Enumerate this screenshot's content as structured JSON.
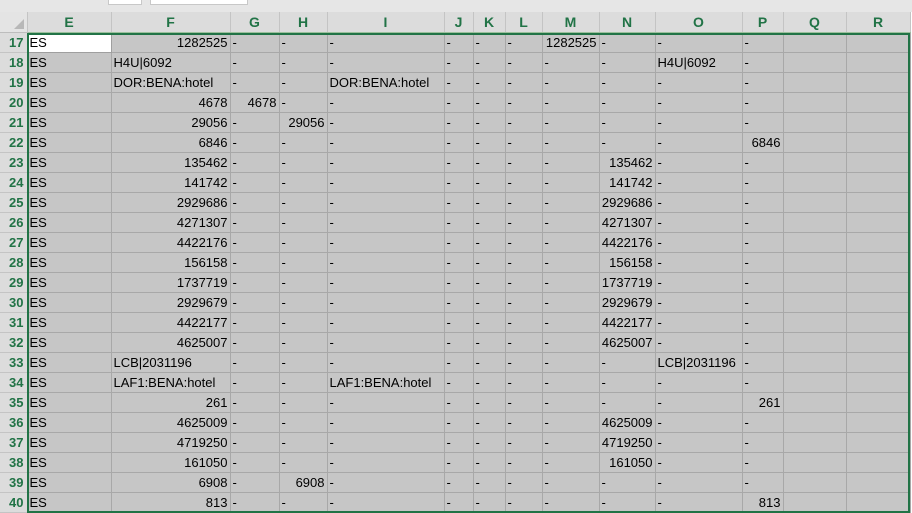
{
  "columns": [
    "E",
    "F",
    "G",
    "H",
    "I",
    "J",
    "K",
    "L",
    "M",
    "N",
    "O",
    "P",
    "Q",
    "R"
  ],
  "rows": [
    {
      "n": "17",
      "c": [
        "ES",
        "1282525",
        "-",
        "-",
        "-",
        "-",
        "-",
        "-",
        "1282525",
        "-",
        "-",
        "-",
        "",
        ""
      ]
    },
    {
      "n": "18",
      "c": [
        "ES",
        "H4U|6092",
        "-",
        "-",
        "-",
        "-",
        "-",
        "-",
        "-",
        "-",
        "H4U|6092",
        "-",
        "",
        ""
      ]
    },
    {
      "n": "19",
      "c": [
        "ES",
        "DOR:BENA:hotel",
        "-",
        "-",
        "DOR:BENA:hotel",
        "-",
        "-",
        "-",
        "-",
        "-",
        "-",
        "-",
        "",
        ""
      ]
    },
    {
      "n": "20",
      "c": [
        "ES",
        "4678",
        "4678",
        "-",
        "-",
        "-",
        "-",
        "-",
        "-",
        "-",
        "-",
        "-",
        "",
        ""
      ]
    },
    {
      "n": "21",
      "c": [
        "ES",
        "29056",
        "-",
        "29056",
        "-",
        "-",
        "-",
        "-",
        "-",
        "-",
        "-",
        "-",
        "",
        ""
      ]
    },
    {
      "n": "22",
      "c": [
        "ES",
        "6846",
        "-",
        "-",
        "-",
        "-",
        "-",
        "-",
        "-",
        "-",
        "-",
        "6846",
        "",
        ""
      ]
    },
    {
      "n": "23",
      "c": [
        "ES",
        "135462",
        "-",
        "-",
        "-",
        "-",
        "-",
        "-",
        "-",
        "135462",
        "-",
        "-",
        "",
        ""
      ]
    },
    {
      "n": "24",
      "c": [
        "ES",
        "141742",
        "-",
        "-",
        "-",
        "-",
        "-",
        "-",
        "-",
        "141742",
        "-",
        "-",
        "",
        ""
      ]
    },
    {
      "n": "25",
      "c": [
        "ES",
        "2929686",
        "-",
        "-",
        "-",
        "-",
        "-",
        "-",
        "-",
        "2929686",
        "-",
        "-",
        "",
        ""
      ]
    },
    {
      "n": "26",
      "c": [
        "ES",
        "4271307",
        "-",
        "-",
        "-",
        "-",
        "-",
        "-",
        "-",
        "4271307",
        "-",
        "-",
        "",
        ""
      ]
    },
    {
      "n": "27",
      "c": [
        "ES",
        "4422176",
        "-",
        "-",
        "-",
        "-",
        "-",
        "-",
        "-",
        "4422176",
        "-",
        "-",
        "",
        ""
      ]
    },
    {
      "n": "28",
      "c": [
        "ES",
        "156158",
        "-",
        "-",
        "-",
        "-",
        "-",
        "-",
        "-",
        "156158",
        "-",
        "-",
        "",
        ""
      ]
    },
    {
      "n": "29",
      "c": [
        "ES",
        "1737719",
        "-",
        "-",
        "-",
        "-",
        "-",
        "-",
        "-",
        "1737719",
        "-",
        "-",
        "",
        ""
      ]
    },
    {
      "n": "30",
      "c": [
        "ES",
        "2929679",
        "-",
        "-",
        "-",
        "-",
        "-",
        "-",
        "-",
        "2929679",
        "-",
        "-",
        "",
        ""
      ]
    },
    {
      "n": "31",
      "c": [
        "ES",
        "4422177",
        "-",
        "-",
        "-",
        "-",
        "-",
        "-",
        "-",
        "4422177",
        "-",
        "-",
        "",
        ""
      ]
    },
    {
      "n": "32",
      "c": [
        "ES",
        "4625007",
        "-",
        "-",
        "-",
        "-",
        "-",
        "-",
        "-",
        "4625007",
        "-",
        "-",
        "",
        ""
      ]
    },
    {
      "n": "33",
      "c": [
        "ES",
        "LCB|2031196",
        "-",
        "-",
        "-",
        "-",
        "-",
        "-",
        "-",
        "-",
        "LCB|2031196",
        "-",
        "",
        ""
      ]
    },
    {
      "n": "34",
      "c": [
        "ES",
        "LAF1:BENA:hotel",
        "-",
        "-",
        "LAF1:BENA:hotel",
        "-",
        "-",
        "-",
        "-",
        "-",
        "-",
        "-",
        "",
        ""
      ]
    },
    {
      "n": "35",
      "c": [
        "ES",
        "261",
        "-",
        "-",
        "-",
        "-",
        "-",
        "-",
        "-",
        "-",
        "-",
        "261",
        "",
        ""
      ]
    },
    {
      "n": "36",
      "c": [
        "ES",
        "4625009",
        "-",
        "-",
        "-",
        "-",
        "-",
        "-",
        "-",
        "4625009",
        "-",
        "-",
        "",
        ""
      ]
    },
    {
      "n": "37",
      "c": [
        "ES",
        "4719250",
        "-",
        "-",
        "-",
        "-",
        "-",
        "-",
        "-",
        "4719250",
        "-",
        "-",
        "",
        ""
      ]
    },
    {
      "n": "38",
      "c": [
        "ES",
        "161050",
        "-",
        "-",
        "-",
        "-",
        "-",
        "-",
        "-",
        "161050",
        "-",
        "-",
        "",
        ""
      ]
    },
    {
      "n": "39",
      "c": [
        "ES",
        "6908",
        "-",
        "6908",
        "-",
        "-",
        "-",
        "-",
        "-",
        "-",
        "-",
        "-",
        "",
        ""
      ]
    },
    {
      "n": "40",
      "c": [
        "ES",
        "813",
        "-",
        "-",
        "-",
        "-",
        "-",
        "-",
        "-",
        "-",
        "-",
        "813",
        "",
        ""
      ]
    }
  ],
  "active_cell": "E17",
  "colors": {
    "header_text": "#217346",
    "selection_border": "#217346",
    "selection_fill": "#c6c6c6",
    "header_bg": "#dcdcdc"
  }
}
